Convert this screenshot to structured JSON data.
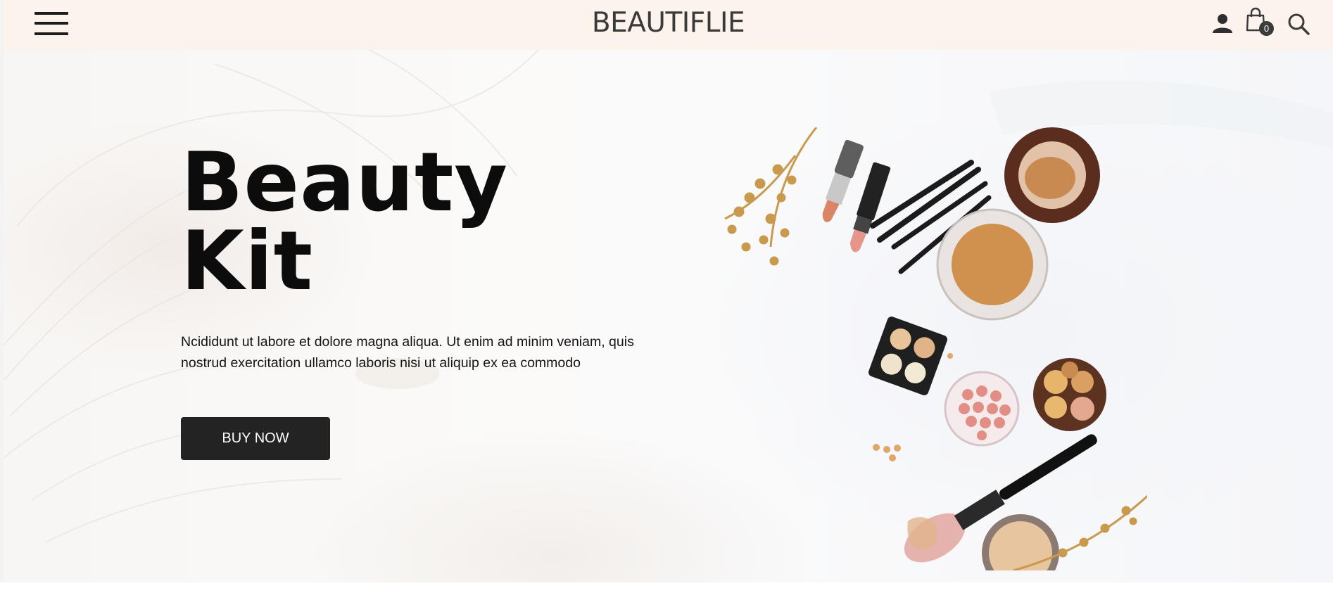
{
  "header": {
    "brand": "BEAUTIFLIE",
    "cart_count": "0",
    "icons": {
      "menu": "hamburger-menu-icon",
      "user": "user-icon",
      "cart": "shopping-bag-icon",
      "search": "search-icon"
    }
  },
  "hero": {
    "title_line1": "Beauty",
    "title_line2": "Kit",
    "description": "Ncididunt ut labore et dolore magna aliqua. Ut enim ad minim veniam, quis nostrud exercitation ullamco laboris nisi ut aliquip ex ea commodo",
    "button_label": "BUY NOW"
  },
  "colors": {
    "header_bg": "#fdf3ed",
    "button_bg": "#232323",
    "button_text": "#ffffff",
    "title_text": "#0c0c0c"
  }
}
